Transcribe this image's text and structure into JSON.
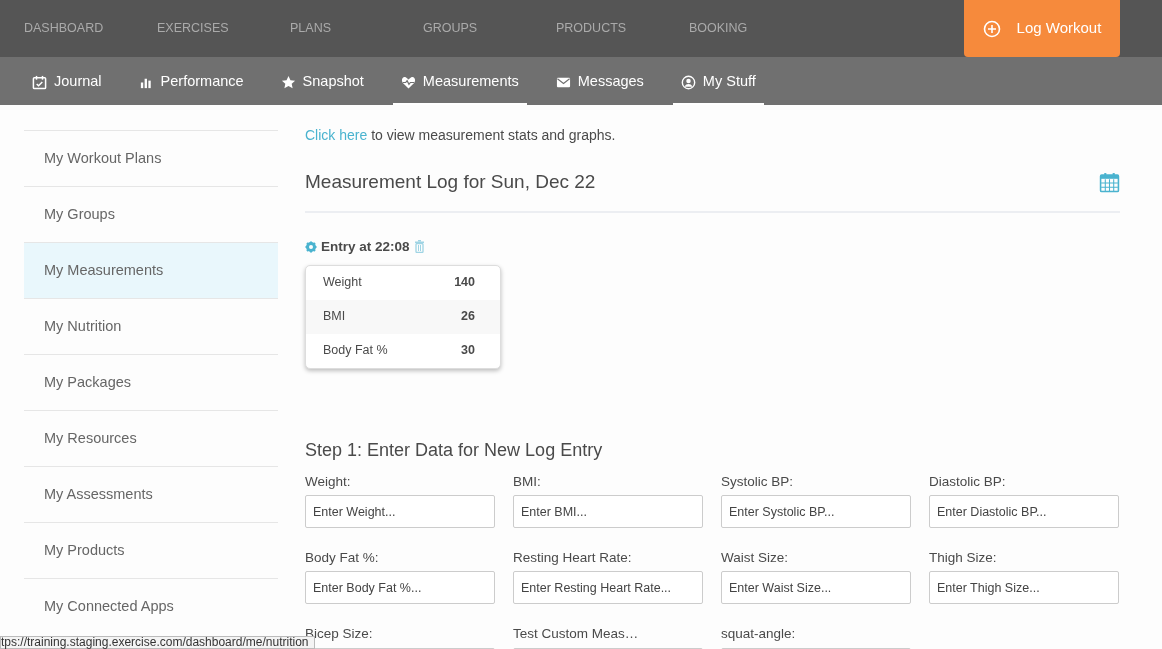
{
  "top_nav": {
    "items": [
      "DASHBOARD",
      "EXERCISES",
      "PLANS",
      "GROUPS",
      "PRODUCTS",
      "BOOKING"
    ],
    "action_button": "Log Workout"
  },
  "sub_nav": [
    {
      "label": "Journal",
      "selected": false
    },
    {
      "label": "Performance",
      "selected": false
    },
    {
      "label": "Snapshot",
      "selected": false
    },
    {
      "label": "Measurements",
      "selected": true
    },
    {
      "label": "Messages",
      "selected": false
    },
    {
      "label": "My Stuff",
      "selected": true
    }
  ],
  "sidebar": {
    "items": [
      {
        "label": "My Workout Plans",
        "selected": false
      },
      {
        "label": "My Groups",
        "selected": false
      },
      {
        "label": "My Measurements",
        "selected": true
      },
      {
        "label": "My Nutrition",
        "selected": false
      },
      {
        "label": "My Packages",
        "selected": false
      },
      {
        "label": "My Resources",
        "selected": false
      },
      {
        "label": "My Assessments",
        "selected": false
      },
      {
        "label": "My Products",
        "selected": false
      },
      {
        "label": "My Connected Apps",
        "selected": false
      }
    ]
  },
  "intro": {
    "link": "Click here",
    "text": "to view measurement stats and graphs."
  },
  "log_title": "Measurement Log for Sun, Dec 22",
  "entry": {
    "title": "Entry at 22:08",
    "rows": [
      {
        "name": "Weight",
        "value": "140"
      },
      {
        "name": "BMI",
        "value": "26"
      },
      {
        "name": "Body Fat %",
        "value": "30"
      }
    ]
  },
  "form": {
    "title": "Step 1: Enter Data for New Log Entry",
    "fields": [
      {
        "label": "Weight:",
        "placeholder": "Enter Weight..."
      },
      {
        "label": "BMI:",
        "placeholder": "Enter BMI..."
      },
      {
        "label": "Systolic BP:",
        "placeholder": "Enter Systolic BP..."
      },
      {
        "label": "Diastolic BP:",
        "placeholder": "Enter Diastolic BP..."
      },
      {
        "label": "Body Fat %:",
        "placeholder": "Enter Body Fat %..."
      },
      {
        "label": "Resting Heart Rate:",
        "placeholder": "Enter Resting Heart Rate..."
      },
      {
        "label": "Waist Size:",
        "placeholder": "Enter Waist Size..."
      },
      {
        "label": "Thigh Size:",
        "placeholder": "Enter Thigh Size..."
      },
      {
        "label": "Bicep Size:"
      },
      {
        "label": "Test Custom Meas…"
      },
      {
        "label": "squat-angle:"
      }
    ]
  },
  "status_bar": "tps://training.staging.exercise.com/dashboard/me/nutrition"
}
